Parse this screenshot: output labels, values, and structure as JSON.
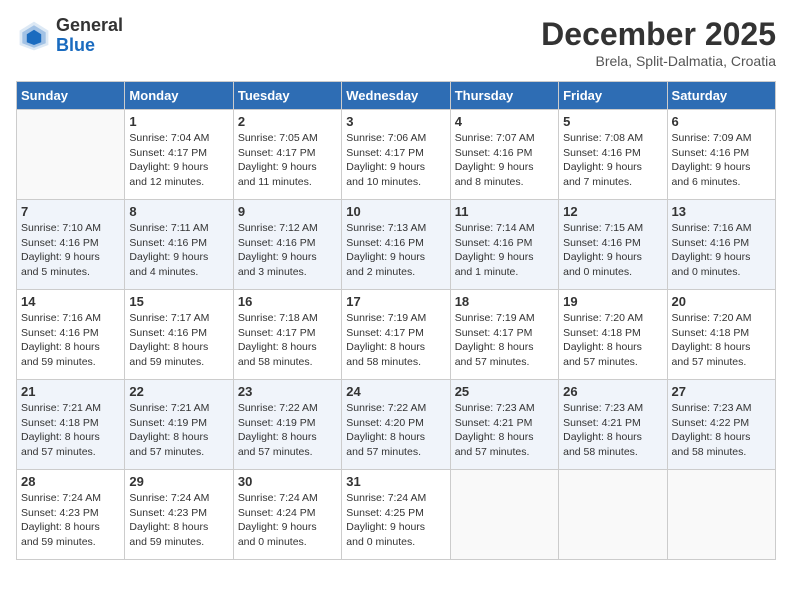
{
  "header": {
    "logo_general": "General",
    "logo_blue": "Blue",
    "title": "December 2025",
    "subtitle": "Brela, Split-Dalmatia, Croatia"
  },
  "days_of_week": [
    "Sunday",
    "Monday",
    "Tuesday",
    "Wednesday",
    "Thursday",
    "Friday",
    "Saturday"
  ],
  "weeks": [
    [
      {
        "day": "",
        "info": ""
      },
      {
        "day": "1",
        "info": "Sunrise: 7:04 AM\nSunset: 4:17 PM\nDaylight: 9 hours\nand 12 minutes."
      },
      {
        "day": "2",
        "info": "Sunrise: 7:05 AM\nSunset: 4:17 PM\nDaylight: 9 hours\nand 11 minutes."
      },
      {
        "day": "3",
        "info": "Sunrise: 7:06 AM\nSunset: 4:17 PM\nDaylight: 9 hours\nand 10 minutes."
      },
      {
        "day": "4",
        "info": "Sunrise: 7:07 AM\nSunset: 4:16 PM\nDaylight: 9 hours\nand 8 minutes."
      },
      {
        "day": "5",
        "info": "Sunrise: 7:08 AM\nSunset: 4:16 PM\nDaylight: 9 hours\nand 7 minutes."
      },
      {
        "day": "6",
        "info": "Sunrise: 7:09 AM\nSunset: 4:16 PM\nDaylight: 9 hours\nand 6 minutes."
      }
    ],
    [
      {
        "day": "7",
        "info": "Sunrise: 7:10 AM\nSunset: 4:16 PM\nDaylight: 9 hours\nand 5 minutes."
      },
      {
        "day": "8",
        "info": "Sunrise: 7:11 AM\nSunset: 4:16 PM\nDaylight: 9 hours\nand 4 minutes."
      },
      {
        "day": "9",
        "info": "Sunrise: 7:12 AM\nSunset: 4:16 PM\nDaylight: 9 hours\nand 3 minutes."
      },
      {
        "day": "10",
        "info": "Sunrise: 7:13 AM\nSunset: 4:16 PM\nDaylight: 9 hours\nand 2 minutes."
      },
      {
        "day": "11",
        "info": "Sunrise: 7:14 AM\nSunset: 4:16 PM\nDaylight: 9 hours\nand 1 minute."
      },
      {
        "day": "12",
        "info": "Sunrise: 7:15 AM\nSunset: 4:16 PM\nDaylight: 9 hours\nand 0 minutes."
      },
      {
        "day": "13",
        "info": "Sunrise: 7:16 AM\nSunset: 4:16 PM\nDaylight: 9 hours\nand 0 minutes."
      }
    ],
    [
      {
        "day": "14",
        "info": "Sunrise: 7:16 AM\nSunset: 4:16 PM\nDaylight: 8 hours\nand 59 minutes."
      },
      {
        "day": "15",
        "info": "Sunrise: 7:17 AM\nSunset: 4:16 PM\nDaylight: 8 hours\nand 59 minutes."
      },
      {
        "day": "16",
        "info": "Sunrise: 7:18 AM\nSunset: 4:17 PM\nDaylight: 8 hours\nand 58 minutes."
      },
      {
        "day": "17",
        "info": "Sunrise: 7:19 AM\nSunset: 4:17 PM\nDaylight: 8 hours\nand 58 minutes."
      },
      {
        "day": "18",
        "info": "Sunrise: 7:19 AM\nSunset: 4:17 PM\nDaylight: 8 hours\nand 57 minutes."
      },
      {
        "day": "19",
        "info": "Sunrise: 7:20 AM\nSunset: 4:18 PM\nDaylight: 8 hours\nand 57 minutes."
      },
      {
        "day": "20",
        "info": "Sunrise: 7:20 AM\nSunset: 4:18 PM\nDaylight: 8 hours\nand 57 minutes."
      }
    ],
    [
      {
        "day": "21",
        "info": "Sunrise: 7:21 AM\nSunset: 4:18 PM\nDaylight: 8 hours\nand 57 minutes."
      },
      {
        "day": "22",
        "info": "Sunrise: 7:21 AM\nSunset: 4:19 PM\nDaylight: 8 hours\nand 57 minutes."
      },
      {
        "day": "23",
        "info": "Sunrise: 7:22 AM\nSunset: 4:19 PM\nDaylight: 8 hours\nand 57 minutes."
      },
      {
        "day": "24",
        "info": "Sunrise: 7:22 AM\nSunset: 4:20 PM\nDaylight: 8 hours\nand 57 minutes."
      },
      {
        "day": "25",
        "info": "Sunrise: 7:23 AM\nSunset: 4:21 PM\nDaylight: 8 hours\nand 57 minutes."
      },
      {
        "day": "26",
        "info": "Sunrise: 7:23 AM\nSunset: 4:21 PM\nDaylight: 8 hours\nand 58 minutes."
      },
      {
        "day": "27",
        "info": "Sunrise: 7:23 AM\nSunset: 4:22 PM\nDaylight: 8 hours\nand 58 minutes."
      }
    ],
    [
      {
        "day": "28",
        "info": "Sunrise: 7:24 AM\nSunset: 4:23 PM\nDaylight: 8 hours\nand 59 minutes."
      },
      {
        "day": "29",
        "info": "Sunrise: 7:24 AM\nSunset: 4:23 PM\nDaylight: 8 hours\nand 59 minutes."
      },
      {
        "day": "30",
        "info": "Sunrise: 7:24 AM\nSunset: 4:24 PM\nDaylight: 9 hours\nand 0 minutes."
      },
      {
        "day": "31",
        "info": "Sunrise: 7:24 AM\nSunset: 4:25 PM\nDaylight: 9 hours\nand 0 minutes."
      },
      {
        "day": "",
        "info": ""
      },
      {
        "day": "",
        "info": ""
      },
      {
        "day": "",
        "info": ""
      }
    ]
  ]
}
